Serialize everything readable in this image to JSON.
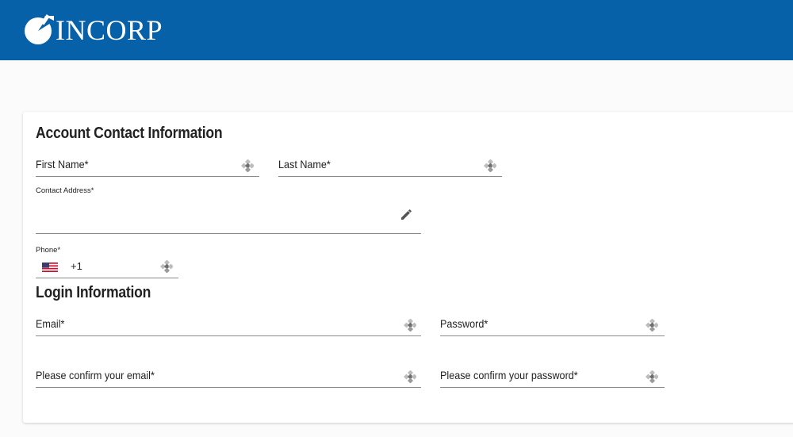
{
  "header": {
    "logo_text": "INCORP",
    "brand_color": "#0761a8"
  },
  "account_contact": {
    "title": "Account Contact Information",
    "first_name_label": "First Name*",
    "last_name_label": "Last Name*",
    "contact_address_label": "Contact Address*",
    "phone_label": "Phone*",
    "phone_country_flag": "us-flag-icon",
    "phone_dial_code": "+1"
  },
  "login": {
    "title": "Login Information",
    "email_label": "Email*",
    "password_label": "Password*",
    "confirm_email_label": "Please confirm your email*",
    "confirm_password_label": "Please confirm your password*"
  },
  "icons": {
    "field_autofill": "key-icon",
    "address_edit": "pencil-icon"
  }
}
